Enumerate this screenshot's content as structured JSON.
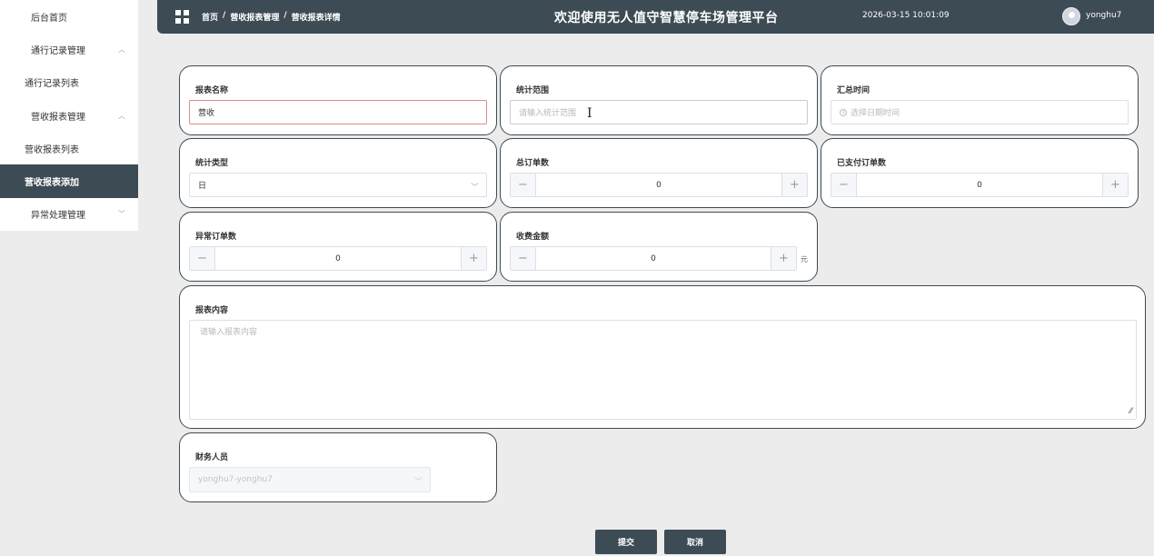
{
  "sidebar": {
    "items": [
      {
        "label": "后台首页",
        "level": 1,
        "chevron": "",
        "active": false
      },
      {
        "label": "通行记录管理",
        "level": 1,
        "chevron": "^",
        "active": false
      },
      {
        "label": "通行记录列表",
        "level": 2,
        "chevron": "",
        "active": false
      },
      {
        "label": "营收报表管理",
        "level": 1,
        "chevron": "^",
        "active": false
      },
      {
        "label": "营收报表列表",
        "level": 2,
        "chevron": "",
        "active": false
      },
      {
        "label": "营收报表添加",
        "level": 2,
        "chevron": "",
        "active": true
      },
      {
        "label": "异常处理管理",
        "level": 1,
        "chevron": "v",
        "active": false
      }
    ]
  },
  "header": {
    "breadcrumb": [
      "首页",
      "营收报表管理",
      "营收报表详情"
    ],
    "breadcrumb_sep": "/",
    "title": "欢迎使用无人值守智慧停车场管理平台",
    "datetime": "2026-03-15 10:01:09",
    "username": "yonghu7"
  },
  "form": {
    "report_name": {
      "label": "报表名称",
      "value": "营收"
    },
    "stat_range": {
      "label": "统计范围",
      "placeholder": "请输入统计范围"
    },
    "summary_time": {
      "label": "汇总时间",
      "placeholder": "选择日期时间"
    },
    "stat_type": {
      "label": "统计类型",
      "value": "日"
    },
    "total_orders": {
      "label": "总订单数",
      "value": "0"
    },
    "paid_orders": {
      "label": "已支付订单数",
      "value": "0"
    },
    "abnormal_orders": {
      "label": "异常订单数",
      "value": "0"
    },
    "charge_amount": {
      "label": "收费金额",
      "value": "0",
      "unit": "元"
    },
    "report_content": {
      "label": "报表内容",
      "placeholder": "请输入报表内容"
    },
    "finance_staff": {
      "label": "财务人员",
      "value": "yonghu7-yonghu7"
    }
  },
  "stepper_minus": "−",
  "stepper_plus": "+",
  "actions": {
    "submit": "提交",
    "cancel": "取消"
  },
  "colors": {
    "primary": "#3d4b55",
    "background": "#ececec",
    "error_border": "#d98c8c"
  }
}
